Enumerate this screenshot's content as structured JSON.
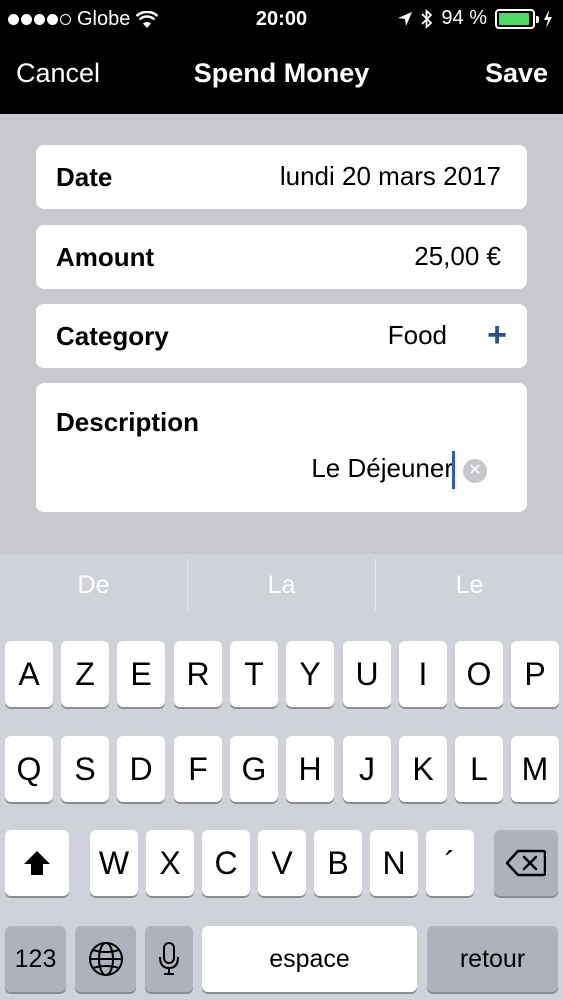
{
  "status_bar": {
    "carrier": "Globe",
    "time": "20:00",
    "battery": "94 %",
    "battery_level": 0.94,
    "icons": [
      "signal-dots-icon",
      "wifi-icon",
      "location-arrow-icon",
      "bluetooth-icon",
      "battery-icon",
      "charging-bolt-icon"
    ]
  },
  "nav": {
    "cancel": "Cancel",
    "title": "Spend Money",
    "save": "Save"
  },
  "form": {
    "date": {
      "label": "Date",
      "value": "lundi 20 mars 2017"
    },
    "amount": {
      "label": "Amount",
      "value": "25,00 €"
    },
    "category": {
      "label": "Category",
      "value": "Food",
      "add_icon": "plus-icon"
    },
    "description": {
      "label": "Description",
      "value": "Le Déjeuner"
    }
  },
  "suggestions": [
    "De",
    "La",
    "Le"
  ],
  "keyboard": {
    "row1": [
      "A",
      "Z",
      "E",
      "R",
      "T",
      "Y",
      "U",
      "I",
      "O",
      "P"
    ],
    "row2": [
      "Q",
      "S",
      "D",
      "F",
      "G",
      "H",
      "J",
      "K",
      "L",
      "M"
    ],
    "row3": [
      "W",
      "X",
      "C",
      "V",
      "B",
      "N",
      "´"
    ],
    "numbers": "123",
    "space": "espace",
    "return": "retour"
  }
}
